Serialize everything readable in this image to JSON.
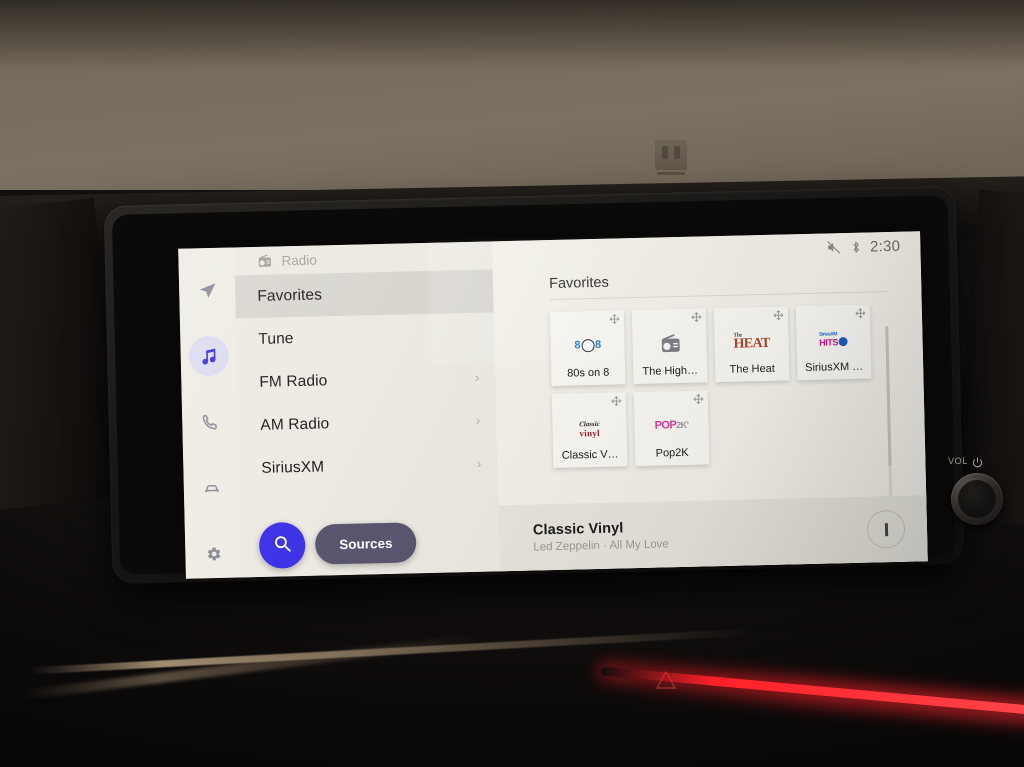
{
  "status": {
    "mute_icon": "sound-off-icon",
    "bluetooth_icon": "bluetooth-icon",
    "clock": "2:30"
  },
  "rail": {
    "items": [
      {
        "icon": "navigation-arrow-icon",
        "name": "nav",
        "active": false
      },
      {
        "icon": "music-note-icon",
        "name": "media",
        "active": true
      },
      {
        "icon": "phone-icon",
        "name": "phone",
        "active": false
      },
      {
        "icon": "car-icon",
        "name": "vehicle",
        "active": false
      },
      {
        "icon": "gear-icon",
        "name": "settings",
        "active": false
      }
    ]
  },
  "source_header": {
    "icon": "radio-icon",
    "label": "Radio"
  },
  "menu": {
    "items": [
      {
        "label": "Favorites",
        "selected": true,
        "chevron": ""
      },
      {
        "label": "Tune",
        "selected": false,
        "chevron": ""
      },
      {
        "label": "FM Radio",
        "selected": false,
        "chevron": "›"
      },
      {
        "label": "AM Radio",
        "selected": false,
        "chevron": "›"
      },
      {
        "label": "SiriusXM",
        "selected": false,
        "chevron": "›"
      }
    ]
  },
  "actions": {
    "search_icon": "search-icon",
    "sources_label": "Sources"
  },
  "favorites": {
    "title": "Favorites",
    "tiles": [
      {
        "label": "80s on 8",
        "logo": "80s-on-8-logo",
        "move_icon": "move-handle-icon"
      },
      {
        "label": "The High…",
        "logo": "generic-radio-logo",
        "move_icon": "move-handle-icon"
      },
      {
        "label": "The Heat",
        "logo": "the-heat-logo",
        "move_icon": "move-handle-icon"
      },
      {
        "label": "SiriusXM …",
        "logo": "siriusxm-hits-logo",
        "move_icon": "move-handle-icon"
      },
      {
        "label": "Classic V…",
        "logo": "classic-vinyl-logo",
        "move_icon": "move-handle-icon"
      },
      {
        "label": "Pop2K",
        "logo": "pop2k-logo",
        "move_icon": "move-handle-icon"
      }
    ]
  },
  "now_playing": {
    "title": "Classic Vinyl",
    "subtitle": "Led Zeppelin · All My Love",
    "transport_icon": "pause-icon"
  },
  "hardware": {
    "volume_label": "VOL",
    "power_icon": "power-icon",
    "hazard_icon": "hazard-triangle-icon"
  },
  "colors": {
    "accent_blue": "#3f33e8",
    "sources_pill": "#5a5670",
    "screen_bg": "#f4f1ea",
    "ambient_red": "#ff2028"
  }
}
